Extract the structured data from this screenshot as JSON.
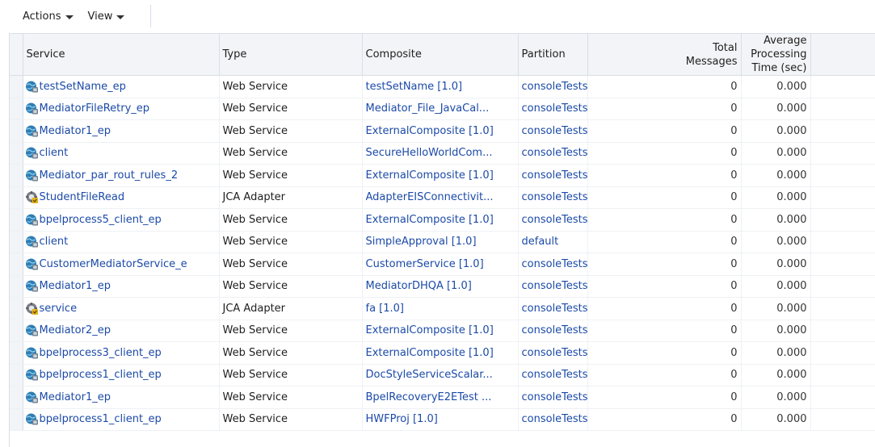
{
  "toolbar": {
    "actions_label": "Actions",
    "view_label": "View"
  },
  "columns": {
    "service": "Service",
    "type": "Type",
    "composite": "Composite",
    "partition": "Partition",
    "total_line1": "Total",
    "total_line2": "Messages",
    "avg_line1": "Average Processing",
    "avg_line2": "Time (sec)"
  },
  "rows": [
    {
      "service": "testSetName_ep",
      "icon": "web-service-icon",
      "type": "Web Service",
      "composite": "testSetName [1.0]",
      "partition": "consoleTests",
      "total": "0",
      "avg": "0.000"
    },
    {
      "service": "MediatorFileRetry_ep",
      "icon": "web-service-icon",
      "type": "Web Service",
      "composite": "Mediator_File_JavaCal...",
      "partition": "consoleTests",
      "total": "0",
      "avg": "0.000"
    },
    {
      "service": "Mediator1_ep",
      "icon": "web-service-icon",
      "type": "Web Service",
      "composite": "ExternalComposite [1.0]",
      "partition": "consoleTests",
      "total": "0",
      "avg": "0.000"
    },
    {
      "service": "client",
      "icon": "web-service-icon",
      "type": "Web Service",
      "composite": "SecureHelloWorldCom...",
      "partition": "consoleTests",
      "total": "0",
      "avg": "0.000"
    },
    {
      "service": "Mediator_par_rout_rules_2",
      "icon": "web-service-icon",
      "type": "Web Service",
      "composite": "ExternalComposite [1.0]",
      "partition": "consoleTests",
      "total": "0",
      "avg": "0.000"
    },
    {
      "service": "StudentFileRead",
      "icon": "jca-adapter-icon",
      "type": "JCA Adapter",
      "composite": "AdapterEISConnectivit...",
      "partition": "consoleTests",
      "total": "0",
      "avg": "0.000"
    },
    {
      "service": "bpelprocess5_client_ep",
      "icon": "web-service-icon",
      "type": "Web Service",
      "composite": "ExternalComposite [1.0]",
      "partition": "consoleTests",
      "total": "0",
      "avg": "0.000"
    },
    {
      "service": "client",
      "icon": "web-service-icon",
      "type": "Web Service",
      "composite": "SimpleApproval [1.0]",
      "partition": "default",
      "total": "0",
      "avg": "0.000"
    },
    {
      "service": "CustomerMediatorService_e",
      "icon": "web-service-icon",
      "type": "Web Service",
      "composite": "CustomerService [1.0]",
      "partition": "consoleTests",
      "total": "0",
      "avg": "0.000"
    },
    {
      "service": "Mediator1_ep",
      "icon": "web-service-icon",
      "type": "Web Service",
      "composite": "MediatorDHQA [1.0]",
      "partition": "consoleTests",
      "total": "0",
      "avg": "0.000"
    },
    {
      "service": "service",
      "icon": "jca-adapter-icon",
      "type": "JCA Adapter",
      "composite": "fa [1.0]",
      "partition": "consoleTests",
      "total": "0",
      "avg": "0.000"
    },
    {
      "service": "Mediator2_ep",
      "icon": "web-service-icon",
      "type": "Web Service",
      "composite": "ExternalComposite [1.0]",
      "partition": "consoleTests",
      "total": "0",
      "avg": "0.000"
    },
    {
      "service": "bpelprocess3_client_ep",
      "icon": "web-service-icon",
      "type": "Web Service",
      "composite": "ExternalComposite [1.0]",
      "partition": "consoleTests",
      "total": "0",
      "avg": "0.000"
    },
    {
      "service": "bpelprocess1_client_ep",
      "icon": "web-service-icon",
      "type": "Web Service",
      "composite": "DocStyleServiceScalar...",
      "partition": "consoleTests",
      "total": "0",
      "avg": "0.000"
    },
    {
      "service": "Mediator1_ep",
      "icon": "web-service-icon",
      "type": "Web Service",
      "composite": "BpelRecoveryE2ETest ...",
      "partition": "consoleTests",
      "total": "0",
      "avg": "0.000"
    },
    {
      "service": "bpelprocess1_client_ep",
      "icon": "web-service-icon",
      "type": "Web Service",
      "composite": "HWFProj [1.0]",
      "partition": "consoleTests",
      "total": "0",
      "avg": "0.000"
    }
  ]
}
